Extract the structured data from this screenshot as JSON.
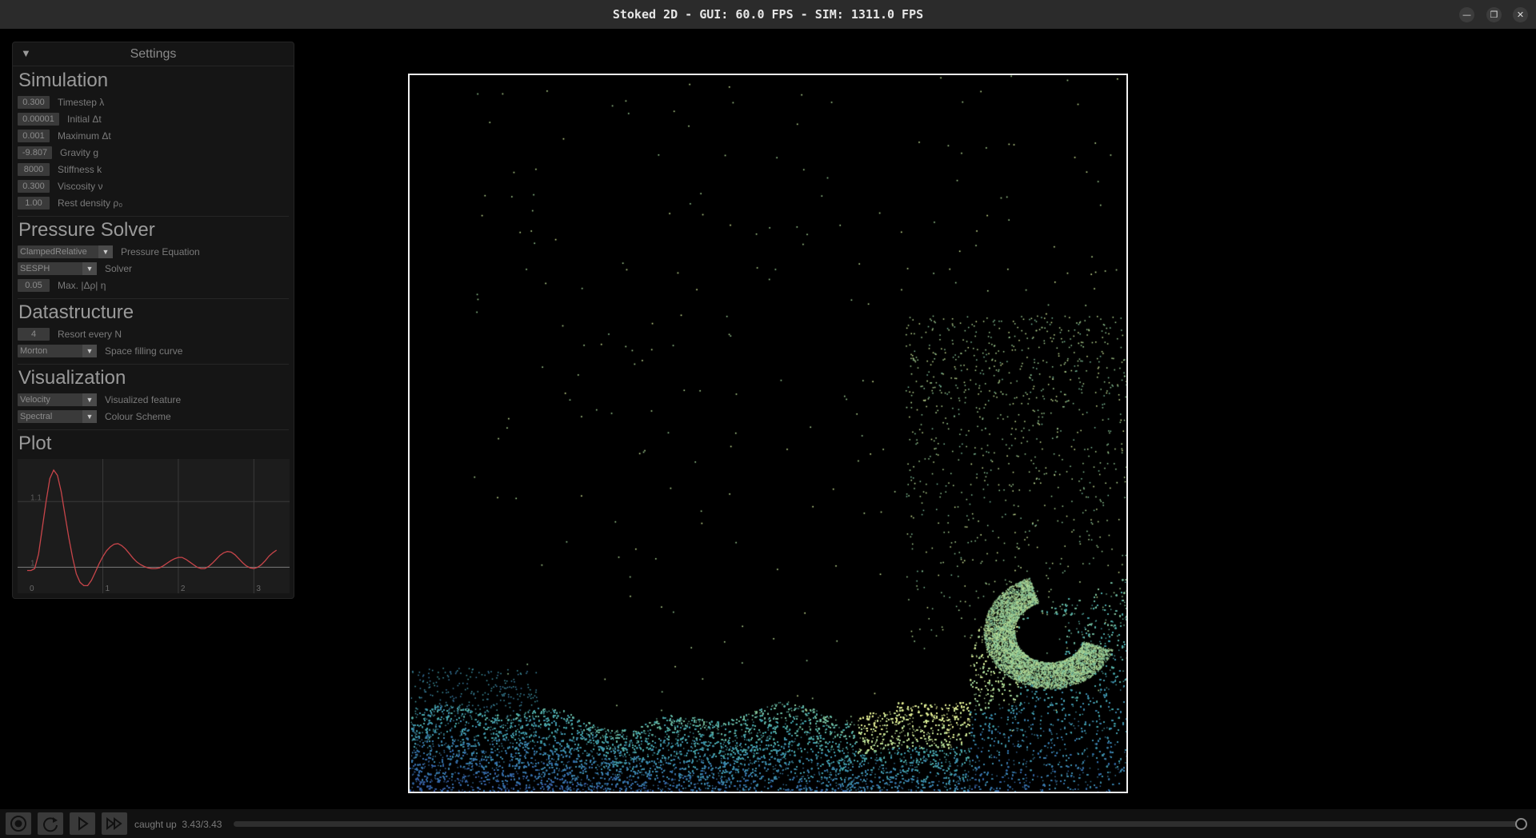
{
  "window": {
    "title": "Stoked 2D  -  GUI: 60.0 FPS  -  SIM: 1311.0 FPS",
    "minimize_icon": "minimize-icon",
    "maximize_icon": "maximize-icon",
    "close_icon": "close-icon"
  },
  "settings": {
    "title": "Settings",
    "collapse_icon": "triangle-down-icon",
    "simulation": {
      "heading": "Simulation",
      "rows": [
        {
          "value": "0.300",
          "label": "Timestep λ"
        },
        {
          "value": "0.00001",
          "label": "Initial Δt"
        },
        {
          "value": "0.001",
          "label": "Maximum Δt"
        },
        {
          "value": "-9.807",
          "label": "Gravity g"
        },
        {
          "value": "8000",
          "label": "Stiffness k"
        },
        {
          "value": "0.300",
          "label": "Viscosity ν"
        },
        {
          "value": "1.00",
          "label": "Rest density ρ₀"
        }
      ]
    },
    "pressure": {
      "heading": "Pressure Solver",
      "equation": {
        "value": "ClampedRelative",
        "label": "Pressure Equation"
      },
      "solver": {
        "value": "SESPH",
        "label": "Solver"
      },
      "max_rho": {
        "value": "0.05",
        "label": "Max. |Δρ| η"
      }
    },
    "datastructure": {
      "heading": "Datastructure",
      "resort": {
        "value": "4",
        "label": "Resort every N"
      },
      "curve": {
        "value": "Morton",
        "label": "Space filling curve"
      }
    },
    "visualization": {
      "heading": "Visualization",
      "feature": {
        "value": "Velocity",
        "label": "Visualized feature"
      },
      "scheme": {
        "value": "Spectral",
        "label": "Colour Scheme"
      }
    },
    "plot": {
      "heading": "Plot"
    }
  },
  "chart_data": {
    "type": "line",
    "x_ticks": [
      "0",
      "1",
      "2",
      "3"
    ],
    "y_ticks": [
      "1",
      "1.1"
    ],
    "xlim": [
      0,
      3.43
    ],
    "ylim": [
      0.97,
      1.16
    ],
    "grid": true,
    "color": "#c8454a",
    "x": [
      0,
      0.05,
      0.1,
      0.15,
      0.2,
      0.25,
      0.3,
      0.35,
      0.4,
      0.45,
      0.5,
      0.55,
      0.6,
      0.65,
      0.7,
      0.75,
      0.8,
      0.85,
      0.9,
      0.95,
      1.0,
      1.05,
      1.1,
      1.15,
      1.2,
      1.25,
      1.3,
      1.35,
      1.4,
      1.45,
      1.5,
      1.55,
      1.6,
      1.65,
      1.7,
      1.75,
      1.8,
      1.85,
      1.9,
      1.95,
      2.0,
      2.05,
      2.1,
      2.15,
      2.2,
      2.25,
      2.3,
      2.35,
      2.4,
      2.45,
      2.5,
      2.55,
      2.6,
      2.65,
      2.7,
      2.75,
      2.8,
      2.85,
      2.9,
      2.95,
      3.0,
      3.05,
      3.1,
      3.15,
      3.2,
      3.25,
      3.3
    ],
    "y": [
      0.995,
      0.995,
      0.998,
      1.02,
      1.06,
      1.1,
      1.135,
      1.148,
      1.14,
      1.115,
      1.08,
      1.045,
      1.015,
      0.99,
      0.977,
      0.972,
      0.972,
      0.98,
      0.992,
      1.005,
      1.016,
      1.025,
      1.031,
      1.035,
      1.036,
      1.033,
      1.028,
      1.021,
      1.014,
      1.008,
      1.004,
      1.001,
      0.999,
      0.998,
      0.998,
      0.999,
      1.002,
      1.006,
      1.01,
      1.013,
      1.015,
      1.015,
      1.012,
      1.008,
      1.004,
      1.0,
      0.998,
      0.998,
      1.001,
      1.006,
      1.012,
      1.018,
      1.022,
      1.024,
      1.023,
      1.019,
      1.013,
      1.007,
      1.002,
      0.999,
      0.998,
      1.0,
      1.004,
      1.01,
      1.017,
      1.022,
      1.026
    ]
  },
  "playback": {
    "record_icon": "record-icon",
    "reset_icon": "reset-icon",
    "play_icon": "play-icon",
    "fast_forward_icon": "fast-forward-icon",
    "status": "caught up",
    "time": "3.43/3.43",
    "progress": 1.0
  },
  "colors": {
    "background": "#000000",
    "panel": "#151515",
    "field": "#3a3a3a",
    "plot_line": "#c8454a",
    "fluid_low": "#3f4f9e",
    "fluid_high": "#e6f19a",
    "box_border": "#f0f0f0"
  }
}
